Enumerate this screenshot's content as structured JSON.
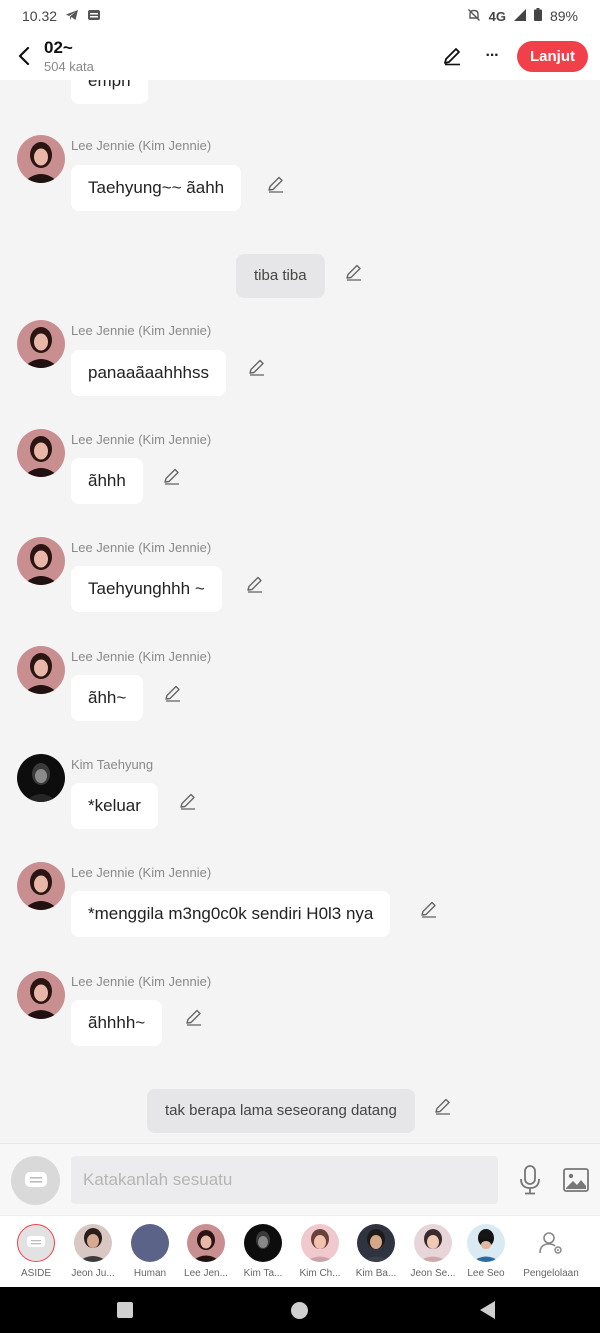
{
  "status_bar": {
    "time": "10.32",
    "network": "4G",
    "battery": "89%"
  },
  "header": {
    "title": "02~",
    "subtitle": "504 kata",
    "continue_label": "Lanjut",
    "more_label": "···"
  },
  "chat": {
    "top_partial_text": "empn",
    "messages": [
      {
        "sender": "Lee Jennie (Kim Jennie)",
        "text": "Taehyung~~ ãahh"
      },
      {
        "narration": "tiba tiba"
      },
      {
        "sender": "Lee Jennie (Kim Jennie)",
        "text": "panaaãaahhhss"
      },
      {
        "sender": "Lee Jennie (Kim Jennie)",
        "text": "ãhhh"
      },
      {
        "sender": "Lee Jennie (Kim Jennie)",
        "text": "Taehyunghhh ~"
      },
      {
        "sender": "Lee Jennie (Kim Jennie)",
        "text": "ãhh~"
      },
      {
        "sender": "Kim Taehyung",
        "text": "*keluar"
      },
      {
        "sender": "Lee Jennie (Kim Jennie)",
        "text": "*menggila m3ng0c0k sendiri H0l3 nya"
      },
      {
        "sender": "Lee Jennie (Kim Jennie)",
        "text": "ãhhhh~"
      },
      {
        "narration": "tak berapa lama seseorang datang"
      }
    ]
  },
  "input": {
    "placeholder": "Katakanlah sesuatu"
  },
  "characters": [
    {
      "label": "ASIDE"
    },
    {
      "label": "Jeon Ju..."
    },
    {
      "label": "Human"
    },
    {
      "label": "Lee Jen..."
    },
    {
      "label": "Kim Ta..."
    },
    {
      "label": "Kim Ch..."
    },
    {
      "label": "Kim Ba..."
    },
    {
      "label": "Jeon Se..."
    },
    {
      "label": "Lee Seo"
    },
    {
      "label": "Pengelolaan"
    }
  ],
  "colors": {
    "accent": "#f2404a",
    "bubble": "#ffffff",
    "narration_bubble": "#e6e6e8",
    "background": "#f4f4f5"
  }
}
